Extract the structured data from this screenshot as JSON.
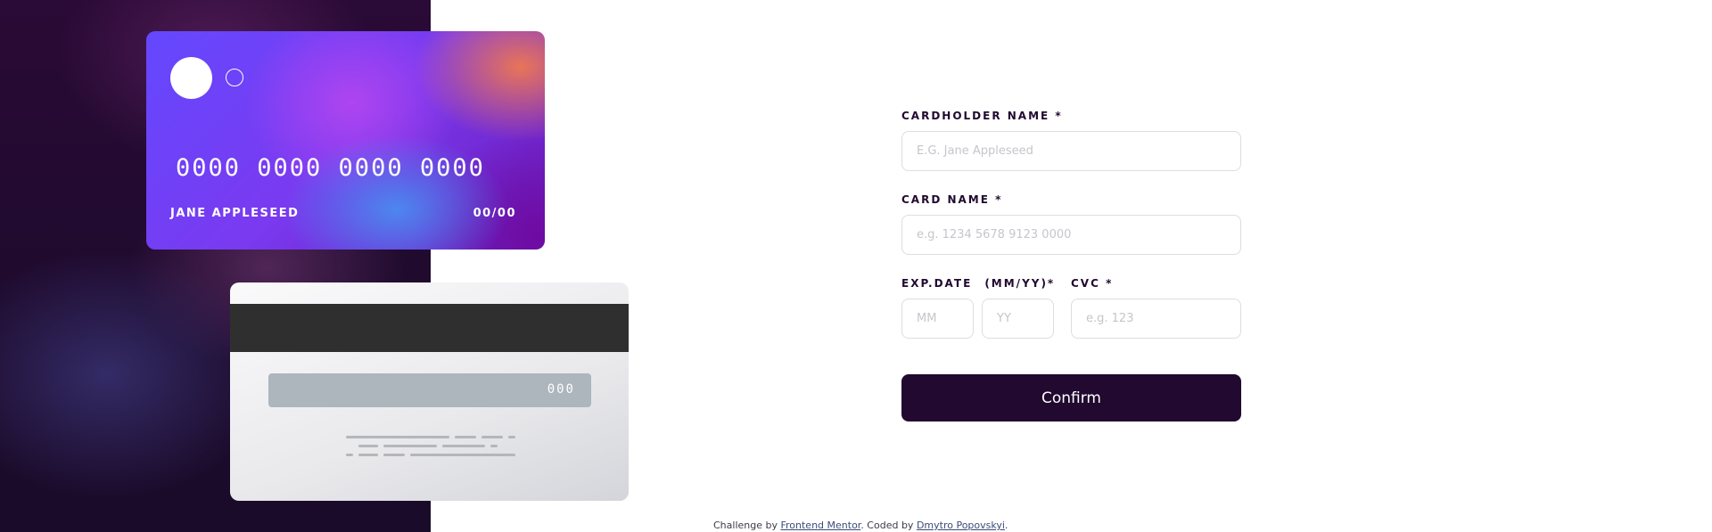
{
  "card_front": {
    "number": "0000 0000 0000 0000",
    "holder": "JANE APPLESEED",
    "expiry": "00/00"
  },
  "card_back": {
    "cvc": "000"
  },
  "form": {
    "cardholder_label": "CARDHOLDER NAME *",
    "cardholder_placeholder": "E.G. Jane Appleseed",
    "card_number_label": "CARD NAME *",
    "card_number_placeholder": "e.g. 1234 5678 9123 0000",
    "exp_label": "EXP.DATE",
    "exp_format_label": "(MM/YY)*",
    "cvc_label": "CVC *",
    "mm_placeholder": "MM",
    "yy_placeholder": "YY",
    "cvc_placeholder": "e.g. 123",
    "confirm_label": "Confirm"
  },
  "footer": {
    "prefix": "Challenge by ",
    "challenge_link": "Frontend Mentor",
    "middle": ". Coded by ",
    "author_link": "Dmytro Popovskyi",
    "suffix": "."
  },
  "colors": {
    "dark_violet": "#21092f",
    "border": "#dedddf",
    "placeholder": "#c8c4cb"
  }
}
